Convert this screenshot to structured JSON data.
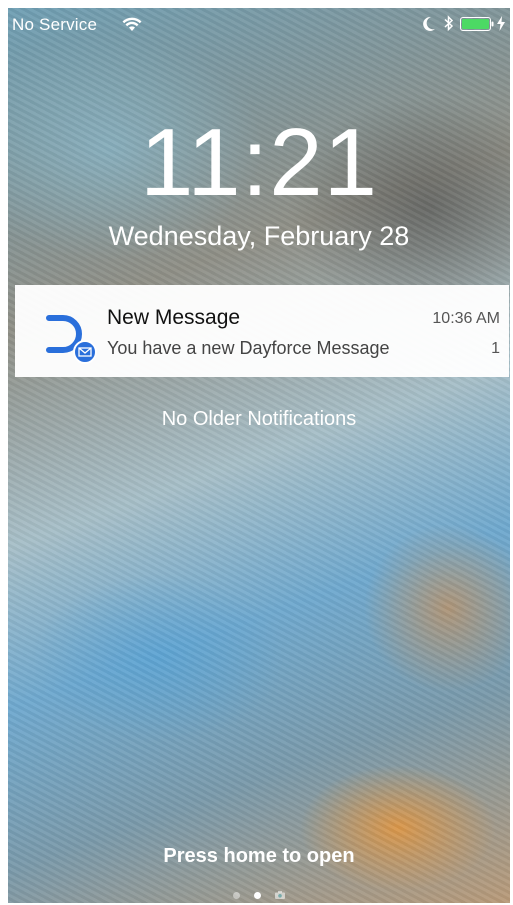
{
  "status_bar": {
    "carrier": "No Service",
    "icons": [
      "wifi-icon",
      "moon-icon",
      "bluetooth-icon",
      "battery-icon",
      "charging-icon"
    ],
    "battery_color": "#4cd964"
  },
  "lock_screen": {
    "time": "11:21",
    "date": "Wednesday, February 28"
  },
  "notification": {
    "app_icon": "dayforce-icon",
    "badge_icon": "mail-icon",
    "title": "New Message",
    "body": "You have a new Dayforce Message",
    "time": "10:36 AM",
    "count": "1",
    "accent_color": "#2a6fdb"
  },
  "no_older_text": "No Older Notifications",
  "press_home_text": "Press home to open",
  "page_indicator": {
    "pages": 3,
    "active_page": 2
  }
}
